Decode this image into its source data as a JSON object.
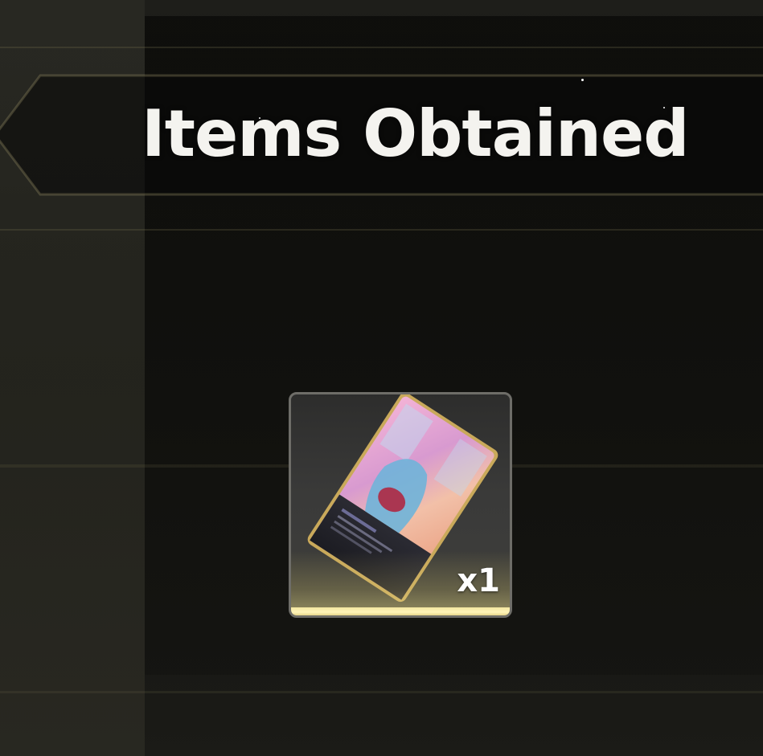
{
  "header": {
    "title": "Items Obtained"
  },
  "reward": {
    "item_name": "card-artwork-icon",
    "quantity_label": "x1"
  },
  "colors": {
    "accent_gold": "#f3e6a0",
    "title_text": "#f4f3ef",
    "slot_border": "#6e6d68"
  }
}
